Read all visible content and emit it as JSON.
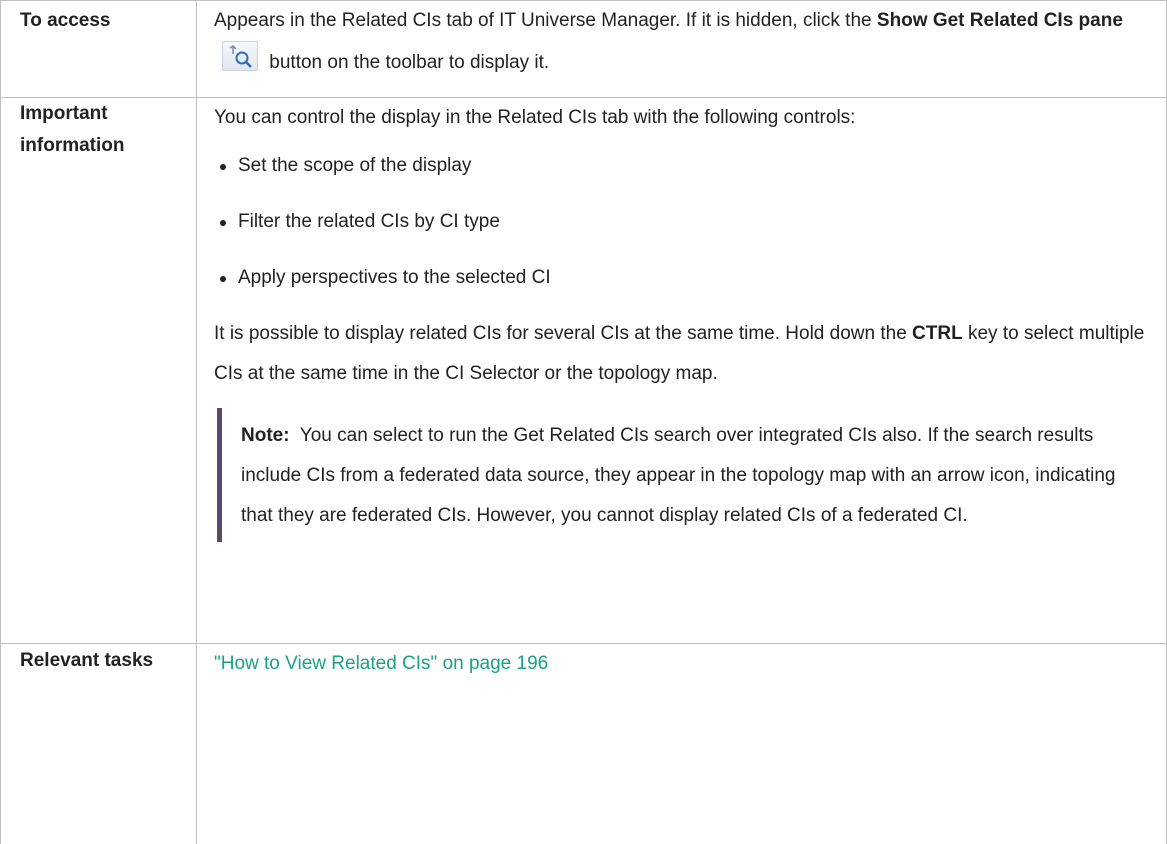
{
  "access": {
    "label": "To access",
    "text_1": "Appears in the Related CIs tab of IT Universe Manager. If it is hidden, click the",
    "text_bold": "Show Get Related CIs pane",
    "text_2": "button on the toolbar to display it.",
    "icon": "search-related-icon"
  },
  "important": {
    "label": "Important information",
    "intro": "You can control the display in the Related CIs tab with the following controls:",
    "bullets": [
      "Set the scope of the display",
      "Filter the related CIs by CI type",
      "Apply perspectives to the selected CI"
    ],
    "para_1": "It is possible to display related CIs for several CIs at the same time. Hold down the",
    "para_bold": "CTRL",
    "para_2": "key to select multiple CIs at the same time in the CI Selector or the topology map.",
    "note_label": "Note:",
    "note_text": "You can select to run the Get Related CIs search over integrated CIs also. If the search results include CIs from a federated data source, they appear in the topology map with an arrow icon, indicating that they are federated CIs. However, you cannot display related CIs of a federated CI."
  },
  "tasks": {
    "label": "Relevant tasks",
    "link_text": "\"How to View Related CIs\" on page 196"
  },
  "colors": {
    "link": "#1aa186",
    "note_bar": "#5b4a66",
    "border": "#bfbfbf"
  }
}
